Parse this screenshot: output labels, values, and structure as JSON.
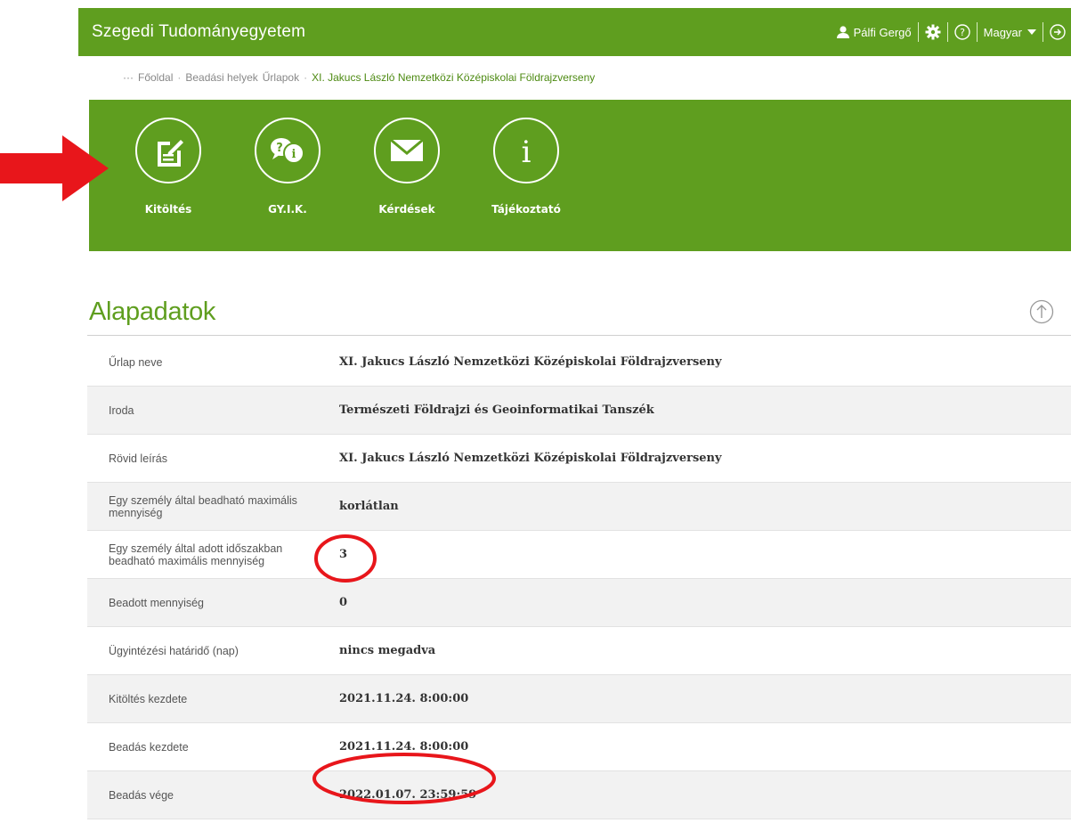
{
  "header": {
    "brand": "Szegedi Tudományegyetem",
    "user_name": "Pálfi Gergő",
    "language": "Magyar",
    "accent_color": "#5f9e1f"
  },
  "breadcrumb": {
    "ellipsis": "···",
    "items": [
      "Főoldal",
      "Beadási helyek",
      "Űrlapok",
      "XI. Jakucs László Nemzetközi Középiskolai Földrajzverseny"
    ]
  },
  "actions": [
    {
      "label": "Kitöltés",
      "icon": "edit-form-icon"
    },
    {
      "label": "GY.I.K.",
      "icon": "faq-icon"
    },
    {
      "label": "Kérdések",
      "icon": "envelope-icon"
    },
    {
      "label": "Tájékoztató",
      "icon": "info-icon"
    }
  ],
  "section": {
    "title": "Alapadatok"
  },
  "details": [
    {
      "label": "Űrlap neve",
      "value": "XI. Jakucs László Nemzetközi Középiskolai Földrajzverseny"
    },
    {
      "label": "Iroda",
      "value": "Természeti Földrajzi és Geoinformatikai Tanszék"
    },
    {
      "label": "Rövid leírás",
      "value": "XI. Jakucs László Nemzetközi Középiskolai Földrajzverseny"
    },
    {
      "label": "Egy személy által beadható maximális mennyiség",
      "value": "korlátlan"
    },
    {
      "label": "Egy személy által adott időszakban beadható maximális mennyiség",
      "value": "3"
    },
    {
      "label": "Beadott mennyiség",
      "value": "0"
    },
    {
      "label": "Ügyintézési határidő (nap)",
      "value": "nincs megadva"
    },
    {
      "label": "Kitöltés kezdete",
      "value": "2021.11.24. 8:00:00"
    },
    {
      "label": "Beadás kezdete",
      "value": "2021.11.24. 8:00:00"
    },
    {
      "label": "Beadás vége",
      "value": "2022.01.07. 23:59:59"
    }
  ]
}
